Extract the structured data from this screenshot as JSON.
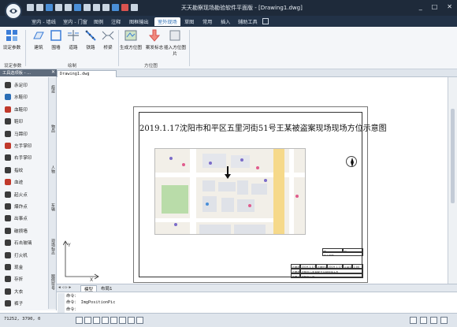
{
  "app": {
    "title": "天天勘察现场勘验软件平面版 - [Drawing1.dwg]",
    "window_controls": [
      "_",
      "□",
      "✕"
    ]
  },
  "tabs": [
    {
      "label": "室内 - 墙线"
    },
    {
      "label": "室内 - 门窗"
    },
    {
      "label": "图例"
    },
    {
      "label": "注释"
    },
    {
      "label": "图框输出"
    },
    {
      "label": "室外现场",
      "active": true
    },
    {
      "label": "草图"
    },
    {
      "label": "常用"
    },
    {
      "label": "插入"
    },
    {
      "label": "辅助工具"
    }
  ],
  "ribbon": {
    "group1_buttons": [
      {
        "label": "设定参数",
        "icon": "settings-grid-icon"
      },
      {
        "label": "建筑",
        "icon": "building-icon"
      },
      {
        "label": "围墙",
        "icon": "wall-icon"
      },
      {
        "label": "道路",
        "icon": "road-icon"
      },
      {
        "label": "铁路",
        "icon": "railway-icon"
      },
      {
        "label": "桥梁",
        "icon": "bridge-icon"
      }
    ],
    "group2_buttons": [
      {
        "label": "生成方位图",
        "icon": "map-icon"
      },
      {
        "label": "案发标志",
        "icon": "incident-marker-icon"
      },
      {
        "label": "插入方位图片",
        "icon": "insert-picture-icon"
      }
    ],
    "group_labels": {
      "settings": "设定参数",
      "draw": "绘制",
      "orientation": "方位图"
    }
  },
  "document": {
    "tab_label": "Drawing1.dwg"
  },
  "palette": {
    "header": "工具选项板 - ...",
    "items": [
      {
        "label": "赤足印",
        "icon": "bare-foot-icon"
      },
      {
        "label": "水鞋印",
        "icon": "boot-print-icon"
      },
      {
        "label": "血鞋印",
        "icon": "blood-shoe-icon"
      },
      {
        "label": "鞋印",
        "icon": "shoe-print-icon"
      },
      {
        "label": "马蹄印",
        "icon": "hoof-print-icon"
      },
      {
        "label": "左手掌印",
        "icon": "left-palm-icon"
      },
      {
        "label": "右手掌印",
        "icon": "right-palm-icon"
      },
      {
        "label": "指纹",
        "icon": "fingerprint-icon"
      },
      {
        "label": "血迹",
        "icon": "blood-icon"
      },
      {
        "label": "起火点",
        "icon": "fire-origin-icon"
      },
      {
        "label": "爆炸点",
        "icon": "explosion-icon"
      },
      {
        "label": "出事点",
        "icon": "incident-point-icon"
      },
      {
        "label": "破损墙",
        "icon": "damaged-wall-icon"
      },
      {
        "label": "石击玻璃",
        "icon": "broken-glass-icon"
      },
      {
        "label": "打火机",
        "icon": "lighter-icon"
      },
      {
        "label": "现金",
        "icon": "cash-icon"
      },
      {
        "label": "存折",
        "icon": "passbook-icon"
      },
      {
        "label": "大衣",
        "icon": "coat-icon"
      },
      {
        "label": "裤子",
        "icon": "trousers-icon"
      }
    ],
    "side_tabs": [
      "痕迹",
      "物品",
      "人物",
      "车辆",
      "现场标志",
      "图例符号"
    ]
  },
  "sheet": {
    "title": "2019.1.17沈阳市和平区五里河街51号王某被盗案现场现场方位示意图",
    "title_block": {
      "legend_head": "图",
      "legend_symbol": "例",
      "legend_item": "中心现场",
      "row1": [
        "绘图单位",
        "2019.1.17",
        "绘图时间",
        "2019.1.17",
        "比例尺",
        "1:00"
      ],
      "row2": [
        "绘图单位",
        "沈阳市公安局和平分局刑侦大队"
      ],
      "row3": [
        "绘图人",
        "沈阳市公安"
      ]
    }
  },
  "layout_tabs": [
    {
      "label": "模型",
      "active": true
    },
    {
      "label": "布局1"
    }
  ],
  "command": {
    "lines": [
      "命令：",
      "命令： ImgPositionPic",
      "命令："
    ]
  },
  "status": {
    "coords": "71252, 3790, 0"
  },
  "colors": {
    "titlebar": "#1e2a3a",
    "accent": "#2a6db5",
    "ribbon_bg": "#f4f6f9"
  }
}
